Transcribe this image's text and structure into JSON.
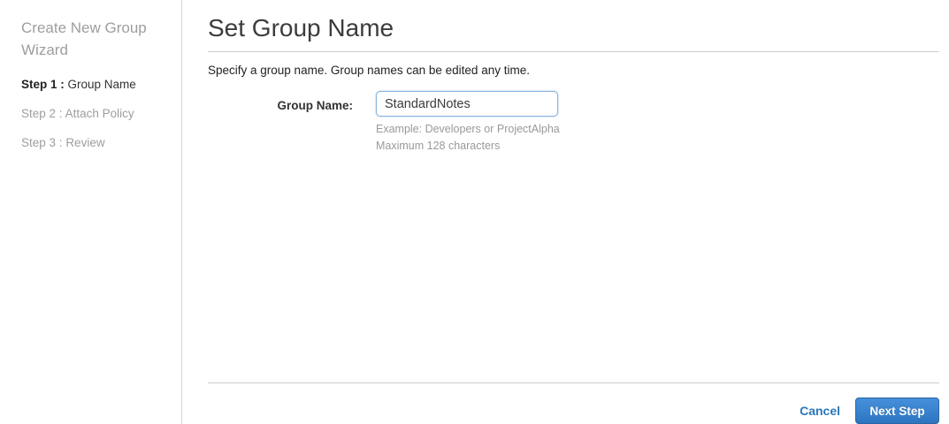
{
  "sidebar": {
    "title": "Create New Group Wizard",
    "steps": [
      {
        "prefix": "Step 1 :",
        "label": "Group Name",
        "active": true
      },
      {
        "prefix": "Step 2 :",
        "label": "Attach Policy",
        "active": false
      },
      {
        "prefix": "Step 3 :",
        "label": "Review",
        "active": false
      }
    ]
  },
  "main": {
    "title": "Set Group Name",
    "description": "Specify a group name. Group names can be edited any time.",
    "form": {
      "group_name_label": "Group Name:",
      "group_name_value": "StandardNotes",
      "hint_example": "Example: Developers or ProjectAlpha",
      "hint_max": "Maximum 128 characters"
    },
    "footer": {
      "cancel_label": "Cancel",
      "next_label": "Next Step"
    }
  },
  "colors": {
    "accent_blue": "#2a77bb",
    "button_gradient_top": "#4691dc",
    "button_gradient_bottom": "#2d74c0",
    "muted_text": "#9e9e9e",
    "dark_text": "#333333",
    "divider": "#cccccc"
  }
}
